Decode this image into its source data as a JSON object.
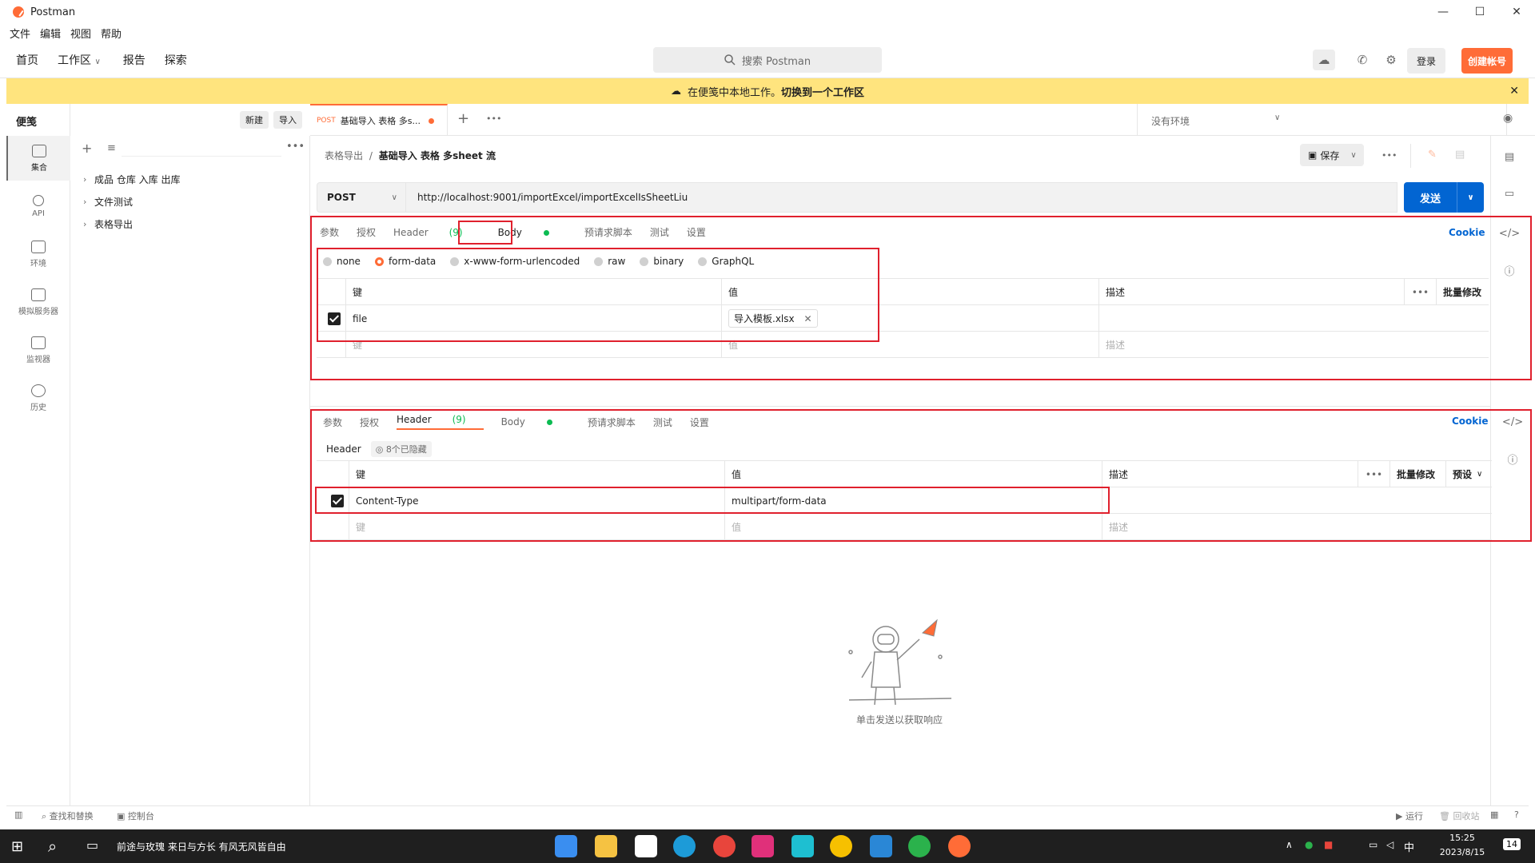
{
  "window": {
    "title": "Postman",
    "min": "—",
    "max": "☐",
    "close": "✕"
  },
  "menu": [
    "文件",
    "编辑",
    "视图",
    "帮助"
  ],
  "header": {
    "nav": [
      "首页",
      "工作区",
      "报告",
      "探索"
    ],
    "search_placeholder": "搜索 Postman",
    "signin": "登录",
    "create_account": "创建帐号"
  },
  "banner": {
    "text": "在便笺中本地工作。",
    "link": "切换到一个工作区"
  },
  "sidebar": {
    "title": "便笺",
    "new_button": "新建",
    "import_button": "导入",
    "rail": [
      "集合",
      "API",
      "环境",
      "模拟服务器",
      "监视器",
      "历史"
    ],
    "tree": [
      "成品 仓库 入库 出库",
      "文件测试",
      "表格导出"
    ]
  },
  "tab": {
    "method": "POST",
    "title": "基础导入 表格 多s..."
  },
  "environment": "没有环境",
  "breadcrumb": {
    "parent": "表格导出",
    "separator": "/",
    "current": "基础导入 表格 多sheet 流"
  },
  "save_button": "保存",
  "request": {
    "method": "POST",
    "url": "http://localhost:9001/importExcel/importExcelIsSheetLiu",
    "send": "发送"
  },
  "req_tabs": [
    "参数",
    "授权",
    "Header",
    "(9)",
    "Body",
    "预请求脚本",
    "测试",
    "设置"
  ],
  "cookie": "Cookie",
  "body_types": [
    "none",
    "form-data",
    "x-www-form-urlencoded",
    "raw",
    "binary",
    "GraphQL"
  ],
  "table_headers": {
    "key": "键",
    "value": "值",
    "desc": "描述",
    "bulk": "批量修改",
    "preset": "预设"
  },
  "form_rows": [
    {
      "key": "file",
      "value": "导入模板.xlsx"
    }
  ],
  "placeholders": {
    "key": "键",
    "value": "值",
    "desc": "描述"
  },
  "header_section": {
    "label": "Header",
    "hidden": "8个已隐藏"
  },
  "header_rows": [
    {
      "key": "Content-Type",
      "value": "multipart/form-data"
    }
  ],
  "response": {
    "hint": "单击发送以获取响应"
  },
  "status": {
    "find": "查找和替换",
    "console": "控制台",
    "run": "运行",
    "trash": "回收站"
  },
  "taskbar": {
    "music": "前途与玫瑰 来日与方长 有风无风皆自由",
    "time": "15:25",
    "date": "2023/8/15",
    "ime": "中",
    "badge": "14"
  }
}
